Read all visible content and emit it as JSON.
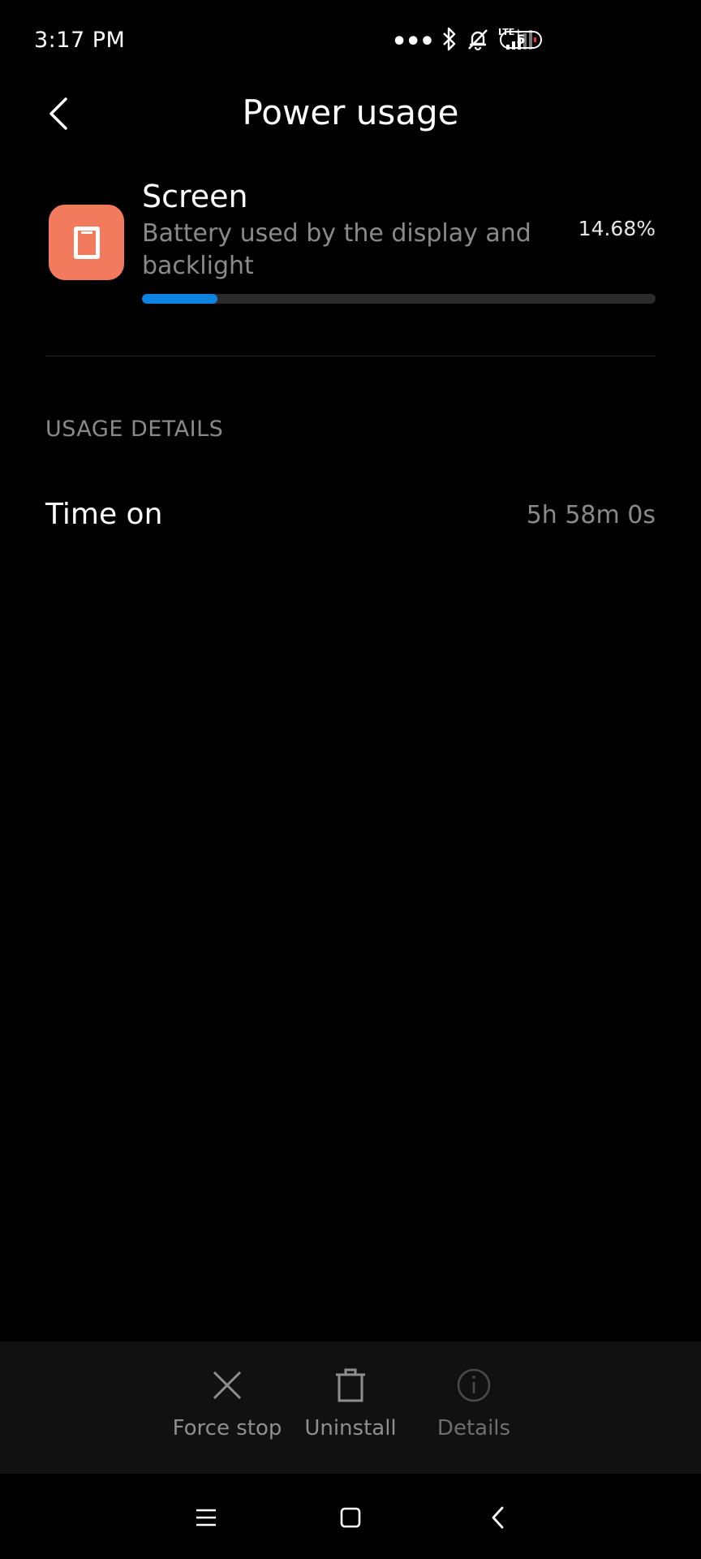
{
  "status_bar": {
    "time": "3:17 PM",
    "network_label": "LTE+",
    "battery_level": "5",
    "icons": [
      "more-dots-icon",
      "bluetooth-icon",
      "bell-off-icon",
      "signal-icon",
      "battery-icon"
    ]
  },
  "header": {
    "title": "Power usage"
  },
  "app": {
    "name": "Screen",
    "description": "Battery used by the display and backlight",
    "percent_label": "14.68%",
    "percent": 14.68,
    "icon": "screen-icon",
    "icon_color": "#f27b5e",
    "bar_color": "#0c84e0"
  },
  "usage_details": {
    "heading": "USAGE DETAILS",
    "rows": [
      {
        "label": "Time on",
        "value": "5h 58m 0s"
      }
    ]
  },
  "actions": [
    {
      "label": "Force stop",
      "icon": "close-icon",
      "enabled": true
    },
    {
      "label": "Uninstall",
      "icon": "trash-icon",
      "enabled": true
    },
    {
      "label": "Details",
      "icon": "info-icon",
      "enabled": false
    }
  ],
  "nav": {
    "icons": [
      "menu-icon",
      "home-icon",
      "back-icon"
    ]
  }
}
